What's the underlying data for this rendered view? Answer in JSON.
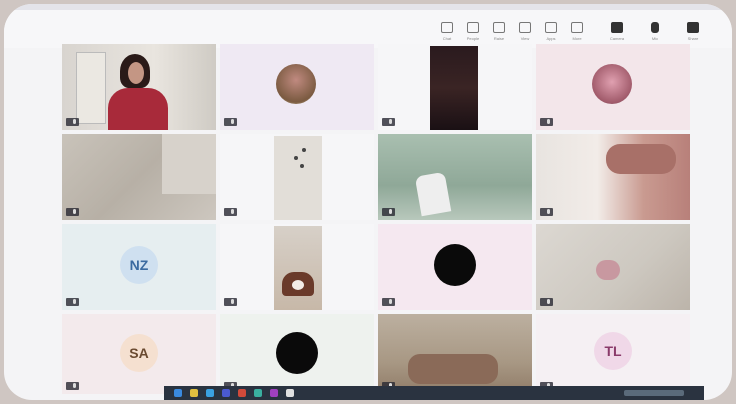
{
  "window": {
    "title": "",
    "top_text": ""
  },
  "toolbar": {
    "items": [
      {
        "label": "Chat",
        "icon": "chat-icon"
      },
      {
        "label": "People",
        "icon": "people-icon"
      },
      {
        "label": "Raise",
        "icon": "hand-icon"
      },
      {
        "label": "View",
        "icon": "view-icon"
      },
      {
        "label": "Apps",
        "icon": "apps-icon"
      },
      {
        "label": "More",
        "icon": "more-icon"
      },
      {
        "label": "Camera",
        "icon": "camera-icon"
      },
      {
        "label": "Mic",
        "icon": "mic-icon"
      },
      {
        "label": "Share",
        "icon": "share-icon"
      }
    ]
  },
  "participants": [
    {
      "name": "",
      "avatar": ""
    },
    {
      "name": "",
      "avatar": ""
    },
    {
      "name": "",
      "avatar": ""
    },
    {
      "name": "",
      "avatar": ""
    },
    {
      "name": "",
      "avatar": ""
    },
    {
      "name": "",
      "avatar": ""
    },
    {
      "name": "",
      "avatar": ""
    },
    {
      "name": "",
      "avatar": ""
    },
    {
      "name": "",
      "avatar": "NZ"
    },
    {
      "name": "",
      "avatar": ""
    },
    {
      "name": "",
      "avatar": ""
    },
    {
      "name": "",
      "avatar": ""
    },
    {
      "name": "",
      "avatar": "SA"
    },
    {
      "name": "",
      "avatar": ""
    },
    {
      "name": "",
      "avatar": ""
    },
    {
      "name": "",
      "avatar": "TL"
    }
  ],
  "colors": {
    "taskbar": "#2a3340",
    "avatar_nz_bg": "#cfe0f0",
    "avatar_nz_fg": "#3a6aa0",
    "avatar_sa_bg": "#f5e0d0",
    "avatar_sa_fg": "#6a4a30",
    "avatar_tl_bg": "#f0d8e8",
    "avatar_tl_fg": "#8a3a6a"
  }
}
